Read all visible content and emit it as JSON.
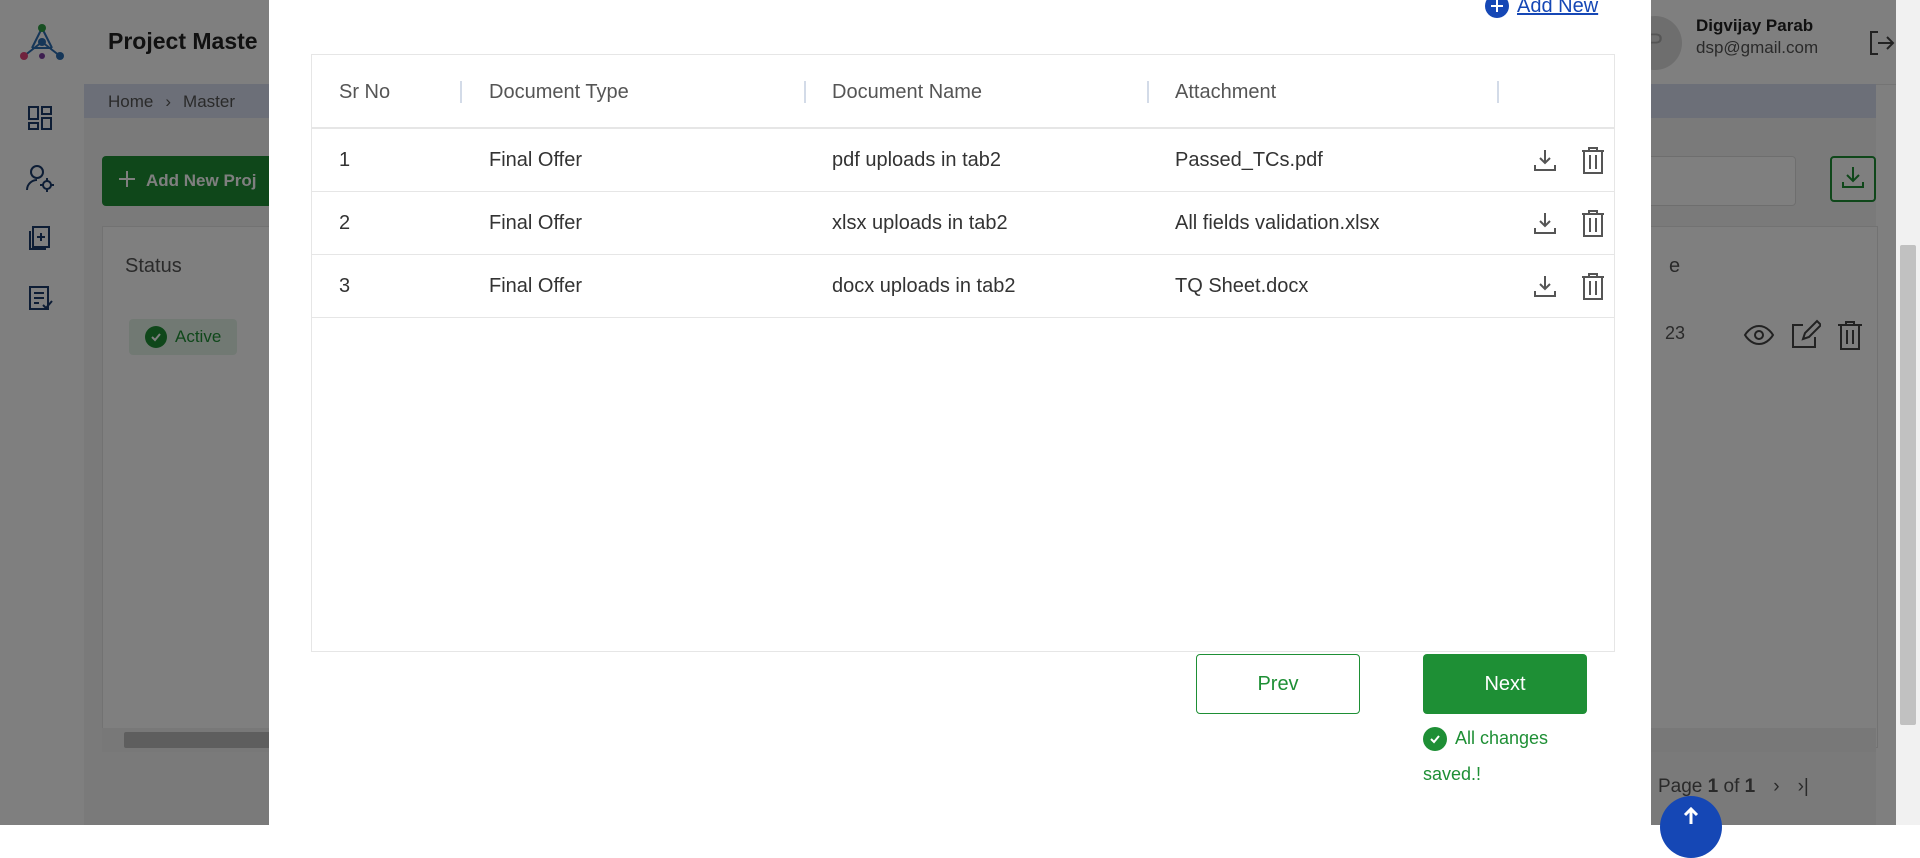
{
  "app": {
    "title": "Project Maste",
    "user_name": "Digvijay Parab",
    "user_email": "dsp@gmail.com",
    "avatar_initial": "P"
  },
  "breadcrumb": {
    "home": "Home",
    "separator": "›",
    "current": "Master"
  },
  "background": {
    "add_button_label": "Add New Proj",
    "status_header": "Status",
    "partial_header": "e",
    "status_badge": "Active",
    "partial_date": "23",
    "pager": {
      "label": "Page",
      "current": "1",
      "of": "of",
      "total": "1"
    }
  },
  "modal": {
    "add_new_label": "Add New",
    "columns": [
      "Sr No",
      "Document Type",
      "Document Name",
      "Attachment"
    ],
    "rows": [
      {
        "sr": "1",
        "type": "Final Offer",
        "name": "pdf uploads in tab2",
        "attachment": "Passed_TCs.pdf"
      },
      {
        "sr": "2",
        "type": "Final Offer",
        "name": "xlsx uploads in tab2",
        "attachment": "All fields validation.xlsx"
      },
      {
        "sr": "3",
        "type": "Final Offer",
        "name": "docx uploads in tab2",
        "attachment": "TQ Sheet.docx"
      }
    ],
    "prev_label": "Prev",
    "next_label": "Next",
    "save_status": "All changes saved.!"
  },
  "colors": {
    "primary_green": "#1e8f35",
    "link_blue": "#1547b5",
    "overlay": "rgba(0,0,0,0.5)"
  },
  "icons": [
    "logo-icon",
    "dashboard-icon",
    "user-settings-icon",
    "add-document-icon",
    "report-icon",
    "logout-icon",
    "download-icon",
    "trash-icon",
    "view-icon",
    "edit-icon",
    "plus-circle-icon",
    "check-circle-icon",
    "arrow-up-icon"
  ]
}
